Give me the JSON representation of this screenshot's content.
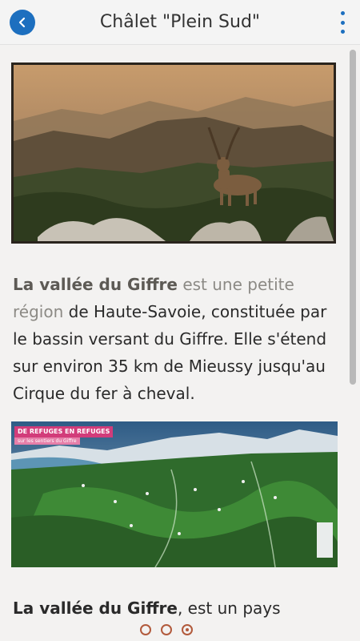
{
  "header": {
    "title": "Châlet \"Plein Sud\"",
    "back_icon": "chevron-left-icon",
    "menu_icon": "more-vertical-icon"
  },
  "content": {
    "photo1_alt": "",
    "para1": {
      "link_bold": "La vallée du Giffre",
      "link_rest": " est une petite région",
      "text": " de Haute-Savoie, constituée par le bassin versant du Giffre. Elle s'étend sur environ 35 km de Mieussy  jusqu'au Cirque du fer à cheval."
    },
    "map": {
      "banner": "DE REFUGES EN REFUGES",
      "subbanner": "sur les sentiers du Giffre"
    },
    "para2": {
      "bold": "La vallée du Giffre",
      "text": ", est un pays"
    }
  },
  "pagination": {
    "count": 3,
    "active_index": 2
  },
  "colors": {
    "accent": "#1d6fbf",
    "dot": "#b25a3c",
    "background": "#f3f2f1"
  }
}
